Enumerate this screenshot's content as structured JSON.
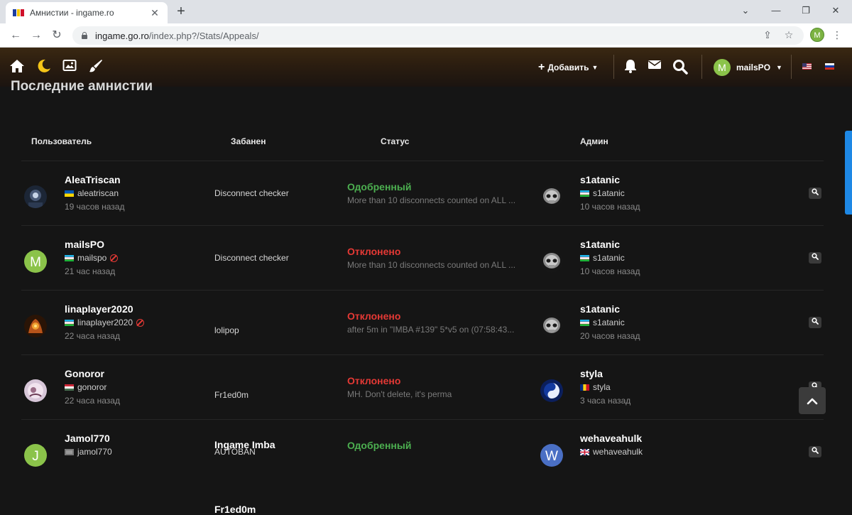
{
  "browser": {
    "tab_title": "Амнистии - ingame.ro",
    "close_glyph": "✕",
    "new_tab_glyph": "+",
    "url_host": "ingame.go.ro",
    "url_path": "/index.php?/Stats/Appeals/",
    "profile_initial": "M"
  },
  "header": {
    "add_label": "Добавить",
    "username": "mailsPO",
    "user_initial": "M"
  },
  "page": {
    "heading": "Последние амнистии",
    "columns": [
      "Пользователь",
      "Забанен",
      "Статус",
      "Админ"
    ]
  },
  "rows": [
    {
      "user": "AleaTriscan",
      "handle": "aleatriscan",
      "flag": "ukraine",
      "banned_icon": false,
      "time": "19 часов назад",
      "ban_title": "",
      "ban_reason": "Disconnect checker",
      "status": "Одобренный",
      "status_type": "ok",
      "note": "More than 10 disconnects counted on ALL ...",
      "admin": "s1atanic",
      "admin_handle": "s1atanic",
      "admin_flag": "uzbekistan",
      "admin_time": "10 часов назад"
    },
    {
      "user": "mailsPO",
      "handle": "mailspo",
      "flag": "uzbekistan",
      "banned_icon": true,
      "time": "21 час назад",
      "ban_title": "",
      "ban_reason": "Disconnect checker",
      "status": "Отклонено",
      "status_type": "no",
      "note": "More than 10 disconnects counted on ALL ...",
      "admin": "s1atanic",
      "admin_handle": "s1atanic",
      "admin_flag": "uzbekistan",
      "admin_time": "10 часов назад"
    },
    {
      "user": "linaplayer2020",
      "handle": "linaplayer2020",
      "flag": "uzbekistan",
      "banned_icon": true,
      "time": "22 часа назад",
      "ban_title": "Ingame Imba",
      "ban_reason": "lolipop",
      "status": "Отклонено",
      "status_type": "no",
      "note": "after 5m in \"IMBA #139\" 5*v5 on (07:58:43...",
      "admin": "s1atanic",
      "admin_handle": "s1atanic",
      "admin_flag": "uzbekistan",
      "admin_time": "20 часов назад"
    },
    {
      "user": "Gonoror",
      "handle": "gonoror",
      "flag": "hungary",
      "banned_icon": false,
      "time": "22 часа назад",
      "ban_title": "Fr1ed0m",
      "ban_reason": "Fr1ed0m",
      "status": "Отклонено",
      "status_type": "no",
      "note": "MH. Don't delete, it's perma",
      "admin": "styla",
      "admin_handle": "styla",
      "admin_flag": "romania",
      "admin_time": "3 часа назад"
    },
    {
      "user": "Jamol770",
      "handle": "jamol770",
      "flag": "unknown",
      "banned_icon": false,
      "time": "",
      "ban_title": "",
      "ban_reason": "AUTOBAN",
      "status": "Одобренный",
      "status_type": "ok",
      "note": "",
      "admin": "wehaveahulk",
      "admin_handle": "wehaveahulk",
      "admin_flag": "uk",
      "admin_time": ""
    }
  ],
  "colors": {
    "approved": "#4caf50",
    "rejected": "#e53935",
    "accent": "#1e88e5"
  },
  "icons": [
    "home-icon",
    "moon-icon",
    "image-icon",
    "brush-icon",
    "bell-icon",
    "mail-icon",
    "search-icon",
    "magnifier-icon",
    "chevron-up-icon"
  ]
}
